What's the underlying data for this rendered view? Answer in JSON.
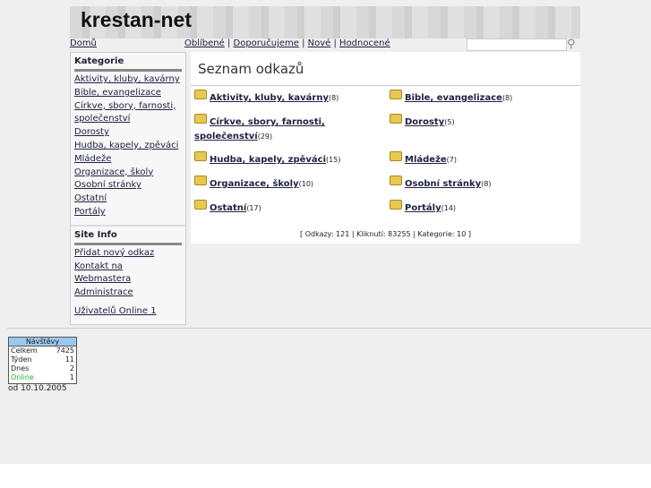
{
  "site": {
    "logo": "krestan-net"
  },
  "nav": {
    "home": "Domů",
    "links": [
      "Oblíbené",
      "Doporučujeme",
      "Nové",
      "Hodnocené"
    ],
    "search_placeholder": ""
  },
  "sidebar": {
    "categories_title": "Kategorie",
    "categories": [
      "Aktivity, kluby, kavárny",
      "Bible, evangelizace",
      "Církve, sbory, farnosti, společenství",
      "Dorosty",
      "Hudba, kapely, zpěváci",
      "Mládeže",
      "Organizace, školy",
      "Osobní stránky",
      "Ostatní",
      "Portály"
    ],
    "siteinfo_title": "Site Info",
    "siteinfo": [
      "Přidat nový odkaz",
      "Kontakt na Webmastera",
      "Administrace"
    ],
    "online": "Uživatelů Online 1"
  },
  "main": {
    "title": "Seznam odkazů",
    "items": [
      {
        "name": "Aktivity, kluby, kavárny",
        "count": "(8)"
      },
      {
        "name": "Bible, evangelizace",
        "count": "(8)"
      },
      {
        "name": "Církve, sbory, farnosti, společenství",
        "count": "(29)"
      },
      {
        "name": "Dorosty",
        "count": "(5)"
      },
      {
        "name": "Hudba, kapely, zpěváci",
        "count": "(15)"
      },
      {
        "name": "Mládeže",
        "count": "(7)"
      },
      {
        "name": "Organizace, školy",
        "count": "(10)"
      },
      {
        "name": "Osobní stránky",
        "count": "(8)"
      },
      {
        "name": "Ostatní",
        "count": "(17)"
      },
      {
        "name": "Portály",
        "count": "(14)"
      }
    ],
    "stats": "[ Odkazy: 121 | Kliknutí: 83255 | Kategorie: 10 ]"
  },
  "counter": {
    "title": "Návštěvy",
    "rows": [
      {
        "label": "Celkem",
        "value": "7425"
      },
      {
        "label": "Týden",
        "value": "11"
      },
      {
        "label": "Dnes",
        "value": "2"
      },
      {
        "label": "Online",
        "value": "1"
      }
    ],
    "since": "od 10.10.2005"
  }
}
